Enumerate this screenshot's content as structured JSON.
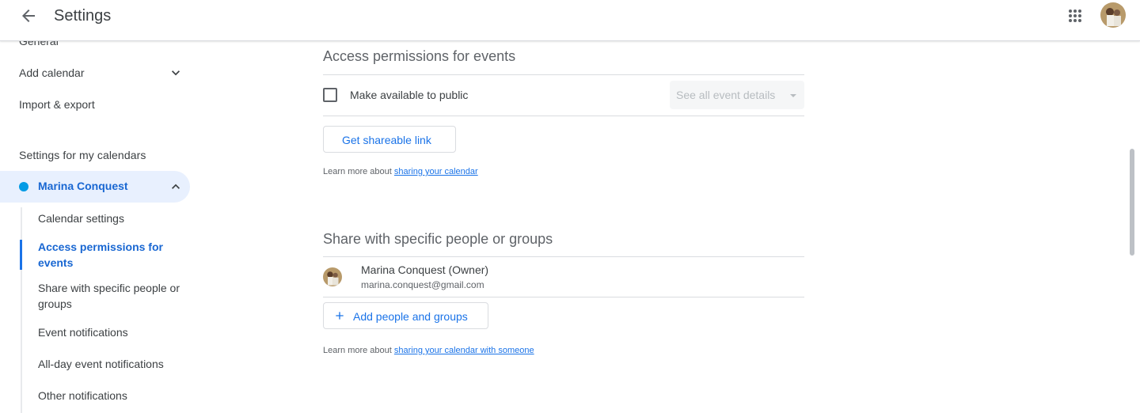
{
  "header": {
    "title": "Settings",
    "back_icon": "arrow-back-icon",
    "apps_icon": "apps-grid-icon",
    "account_avatar": "account-avatar"
  },
  "sidebar": {
    "items": [
      {
        "label": "General"
      },
      {
        "label": "Add calendar",
        "icon": "chevron-down-icon"
      },
      {
        "label": "Import & export"
      }
    ],
    "group_title": "Settings for my calendars",
    "calendar": {
      "label": "Marina Conquest",
      "color": "#039be5",
      "expanded": true
    },
    "sub_items": [
      {
        "label": "Calendar settings",
        "active": false
      },
      {
        "label": "Access permissions for events",
        "active": true
      },
      {
        "label": "Share with specific people or groups",
        "active": false
      },
      {
        "label": "Event notifications",
        "active": false
      },
      {
        "label": "All-day event notifications",
        "active": false
      },
      {
        "label": "Other notifications",
        "active": false
      }
    ]
  },
  "access": {
    "title": "Access permissions for events",
    "public_checkbox_label": "Make available to public",
    "public_checked": false,
    "visibility_select": "See all event details",
    "shareable_link_button": "Get shareable link",
    "learn_prefix": "Learn more about ",
    "learn_link": "sharing your calendar"
  },
  "share": {
    "title": "Share with specific people or groups",
    "people": [
      {
        "name": "Marina Conquest (Owner)",
        "email": "marina.conquest@gmail.com"
      }
    ],
    "add_button": "Add people and groups",
    "learn_prefix": "Learn more about ",
    "learn_link": "sharing your calendar with someone"
  },
  "colors": {
    "accent": "#1a73e8",
    "active_bg": "#e8f0fe",
    "active_text": "#1967d2"
  }
}
